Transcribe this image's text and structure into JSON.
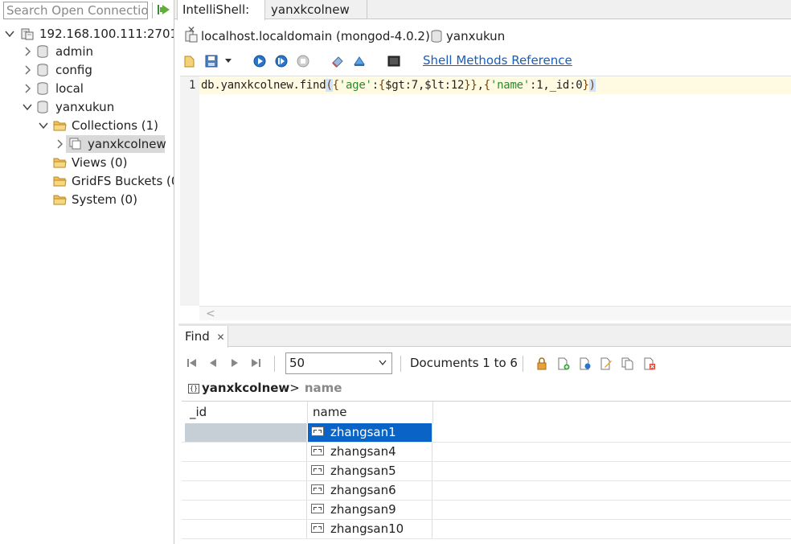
{
  "left": {
    "search_placeholder": "Search Open Connectio",
    "server": "192.168.100.111:27017",
    "databases": [
      {
        "label": "admin"
      },
      {
        "label": "config"
      },
      {
        "label": "local"
      },
      {
        "label": "yanxukun"
      }
    ],
    "folders": {
      "collections": "Collections (1)",
      "collection_item": "yanxkcolnew",
      "views": "Views (0)",
      "gridfs": "GridFS Buckets (0",
      "system": "System (0)"
    }
  },
  "tabs": {
    "intellishell": "IntelliShell:",
    "collection": "yanxkcolnew",
    "close_glyph": "✕"
  },
  "connection": {
    "host": "localhost.localdomain (mongod-4.0.2)",
    "database": "yanxukun"
  },
  "toolbar": {
    "shell_ref_link": "Shell Methods Reference"
  },
  "editor": {
    "line_number": "1",
    "code": {
      "prefix": "db.yanxkcolnew.find",
      "p_open": "(",
      "b1": "{",
      "k_age": "'age'",
      "colon1": ":",
      "b2": "{",
      "cond": "$gt:7,$lt:12",
      "b3": "}}",
      "comma": ",",
      "b4": "{",
      "k_name": "'name'",
      "proj": ":1,_id:0",
      "b5": "}",
      "p_close": ")"
    },
    "scroll_left_glyph": "<"
  },
  "find_panel": {
    "tab_label": "Find",
    "page_size": "50",
    "doc_count": "Documents 1 to 6",
    "breadcrumb_collection": "yanxkcolnew",
    "breadcrumb_arrow": ">",
    "breadcrumb_field": "name",
    "breadcrumb_icon": "{}"
  },
  "grid": {
    "columns": [
      "_id",
      "name"
    ],
    "rows": [
      {
        "name": "zhangsan1"
      },
      {
        "name": "zhangsan4"
      },
      {
        "name": "zhangsan5"
      },
      {
        "name": "zhangsan6"
      },
      {
        "name": "zhangsan9"
      },
      {
        "name": "zhangsan10"
      }
    ]
  },
  "colors": {
    "selection": "#0a64c8",
    "link": "#1a5db8",
    "string": "#2a8a2a"
  }
}
